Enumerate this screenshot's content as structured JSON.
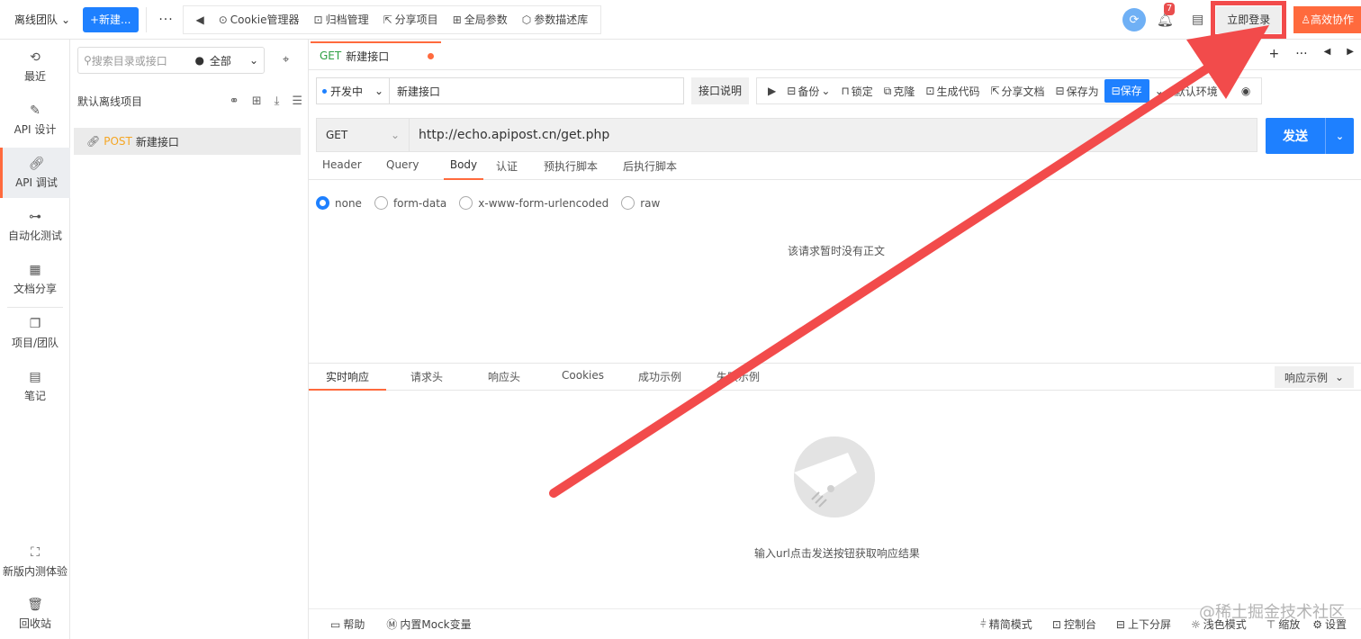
{
  "topbar": {
    "team_label": "离线团队",
    "new_label": "+新建...",
    "tools": [
      {
        "label": "Cookie管理器",
        "icon": "cookie-icon"
      },
      {
        "label": "归档管理",
        "icon": "archive-icon"
      },
      {
        "label": "分享项目",
        "icon": "share-icon"
      },
      {
        "label": "全局参数",
        "icon": "params-icon"
      },
      {
        "label": "参数描述库",
        "icon": "cube-icon"
      }
    ],
    "notification_count": "7",
    "login_label": "立即登录",
    "collab_label": "高效协作"
  },
  "leftnav": {
    "items": [
      {
        "label": "最近",
        "icon": "history-icon"
      },
      {
        "label": "API 设计",
        "icon": "edit-icon"
      },
      {
        "label": "API 调试",
        "icon": "link-icon"
      },
      {
        "label": "自动化测试",
        "icon": "flow-icon"
      },
      {
        "label": "文档分享",
        "icon": "doc-share-icon"
      },
      {
        "label": "项目/团队",
        "icon": "project-icon"
      },
      {
        "label": "笔记",
        "icon": "note-icon"
      }
    ],
    "beta_label": "新版内测体验",
    "trash_label": "回收站"
  },
  "tree": {
    "search_placeholder": "搜索目录或接口",
    "filter_label": "全部",
    "project_name": "默认离线项目",
    "item": {
      "method": "POST",
      "name": "新建接口"
    }
  },
  "tab": {
    "method": "GET",
    "name": "新建接口"
  },
  "request": {
    "env_status": "开发中",
    "name": "新建接口",
    "doc_label": "接口说明",
    "actions": [
      {
        "label": "备份",
        "icon": "backup-icon"
      },
      {
        "label": "锁定",
        "icon": "lock-icon"
      },
      {
        "label": "克隆",
        "icon": "clone-icon"
      },
      {
        "label": "生成代码",
        "icon": "code-icon"
      },
      {
        "label": "分享文档",
        "icon": "share-doc-icon"
      },
      {
        "label": "保存为",
        "icon": "save-as-icon"
      }
    ],
    "save_label": "保存",
    "env_label": "默认环境",
    "method": "GET",
    "url": "http://echo.apipost.cn/get.php",
    "send_label": "发送",
    "tabs": [
      "Header",
      "Query",
      "Body",
      "认证",
      "预执行脚本",
      "后执行脚本"
    ],
    "active_tab": "Body",
    "body_types": [
      "none",
      "form-data",
      "x-www-form-urlencoded",
      "raw"
    ],
    "selected_body_type": "none",
    "empty_body_text": "该请求暂时没有正文"
  },
  "response": {
    "tabs": [
      "实时响应",
      "请求头",
      "响应头",
      "Cookies",
      "成功示例",
      "失败示例"
    ],
    "active_tab": "实时响应",
    "example_label": "响应示例",
    "empty_text": "输入url点击发送按钮获取响应结果"
  },
  "statusbar": {
    "left": [
      {
        "label": "帮助",
        "icon": "help-icon"
      },
      {
        "label": "内置Mock变量",
        "icon": "mock-icon"
      }
    ],
    "right": [
      {
        "label": "精简模式",
        "icon": "compact-icon"
      },
      {
        "label": "控制台",
        "icon": "console-icon"
      },
      {
        "label": "上下分屏",
        "icon": "split-icon"
      },
      {
        "label": "浅色模式",
        "icon": "sun-icon"
      },
      {
        "label": "缩放",
        "icon": "zoom-icon"
      },
      {
        "label": "设置",
        "icon": "settings-icon"
      }
    ]
  },
  "watermark": "@稀土掘金技术社区",
  "colors": {
    "primary": "#1e80ff",
    "accent": "#ff6a3d",
    "annotation": "#f24b4b"
  }
}
